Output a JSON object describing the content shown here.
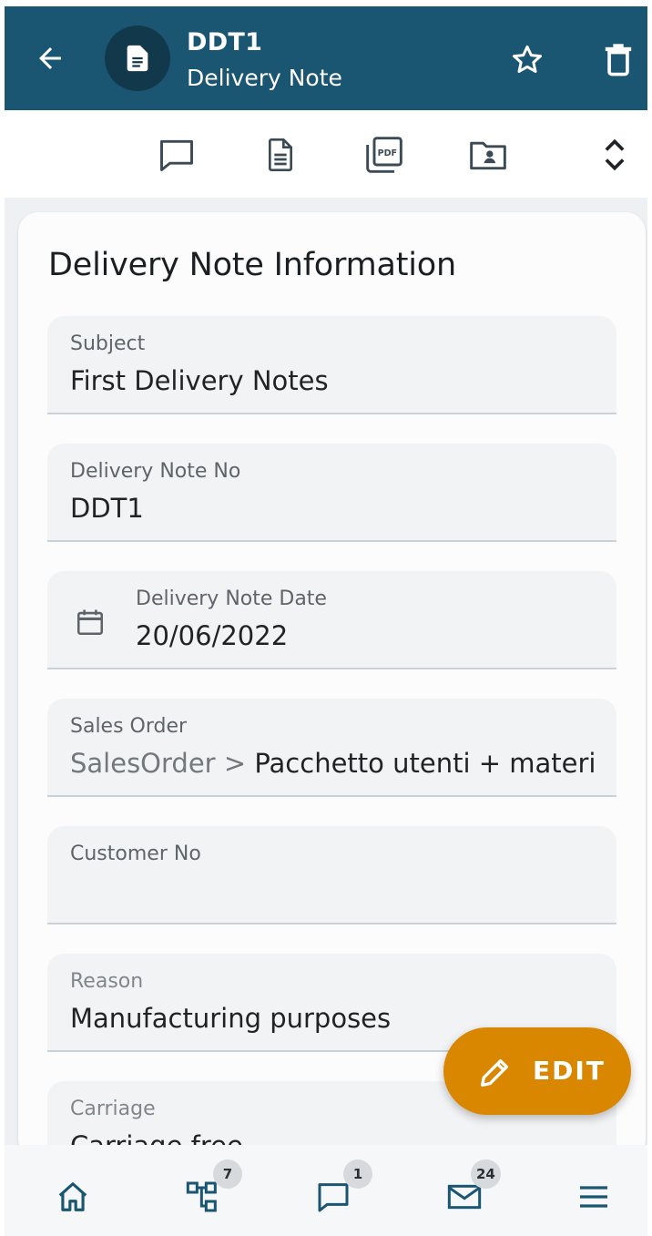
{
  "header": {
    "title": "DDT1",
    "subtitle": "Delivery Note",
    "back_icon": "arrow-left-icon",
    "avatar_icon": "document-icon",
    "star_icon": "star-outline-icon",
    "trash_icon": "trash-icon"
  },
  "toolbar": {
    "items": [
      {
        "icon": "comment-icon"
      },
      {
        "icon": "document-icon"
      },
      {
        "icon": "pdf-icon"
      },
      {
        "icon": "contact-folder-icon"
      },
      {
        "icon": "expand-collapse-icon"
      }
    ]
  },
  "card": {
    "title": "Delivery Note Information",
    "fields": [
      {
        "label": "Subject",
        "value": "First Delivery Notes"
      },
      {
        "label": "Delivery Note No",
        "value": "DDT1"
      },
      {
        "label": "Delivery Note Date",
        "value": "20/06/2022",
        "icon": "calendar-icon"
      },
      {
        "label": "Sales Order",
        "value_prefix": "SalesOrder > ",
        "value": "Pacchetto utenti + materiale"
      },
      {
        "label": "Customer No",
        "value": ""
      },
      {
        "label": "Reason",
        "value": "Manufacturing purposes"
      },
      {
        "label": "Carriage",
        "value": "Carriage free"
      }
    ]
  },
  "fab": {
    "label": "EDIT",
    "icon": "pencil-icon"
  },
  "bottom_nav": {
    "items": [
      {
        "icon": "home-icon"
      },
      {
        "icon": "hierarchy-icon",
        "badge": "7"
      },
      {
        "icon": "comment-icon",
        "badge": "1"
      },
      {
        "icon": "mail-icon",
        "badge": "24"
      },
      {
        "icon": "menu-icon"
      }
    ]
  },
  "colors": {
    "header_bg": "#1a5671",
    "accent": "#d98700",
    "nav_icon": "#1a5671"
  }
}
